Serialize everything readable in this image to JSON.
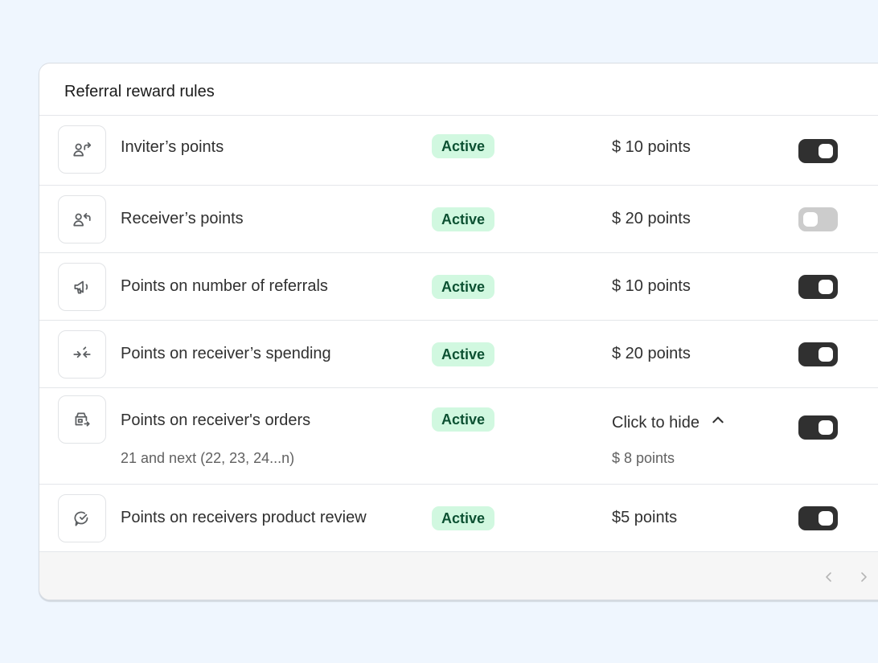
{
  "card": {
    "title": "Referral reward rules"
  },
  "rows": [
    {
      "icon": "person-arrow-forward-icon",
      "label": "Inviter’s points",
      "status": "Active",
      "value": "$ 10 points",
      "enabled": true
    },
    {
      "icon": "person-arrow-return-icon",
      "label": "Receiver’s points",
      "status": "Active",
      "value": "$ 20 points",
      "enabled": false
    },
    {
      "icon": "megaphone-icon",
      "label": "Points on number of referrals",
      "status": "Active",
      "value": "$ 10 points",
      "enabled": true
    },
    {
      "icon": "arrows-merge-icon",
      "label": "Points on receiver’s spending",
      "status": "Active",
      "value": "$ 20 points",
      "enabled": true
    },
    {
      "icon": "order-box-icon",
      "label": "Points on receiver's orders",
      "sublabel": "21 and next (22, 23, 24...n)",
      "status": "Active",
      "link_text": "Click to hide",
      "value": "$ 8 points",
      "enabled": true
    },
    {
      "icon": "chat-check-icon",
      "label": "Points on receivers product review",
      "status": "Active",
      "value": "$5 points",
      "enabled": true
    }
  ],
  "colors": {
    "page_background": "#eff6fe",
    "badge_background": "#d1f8e0",
    "badge_text": "#0c5132",
    "toggle_on": "#303030",
    "toggle_off": "#cccccc"
  },
  "pagination": {
    "previous_icon": "chevron-left-icon",
    "next_icon": "chevron-right-icon"
  }
}
